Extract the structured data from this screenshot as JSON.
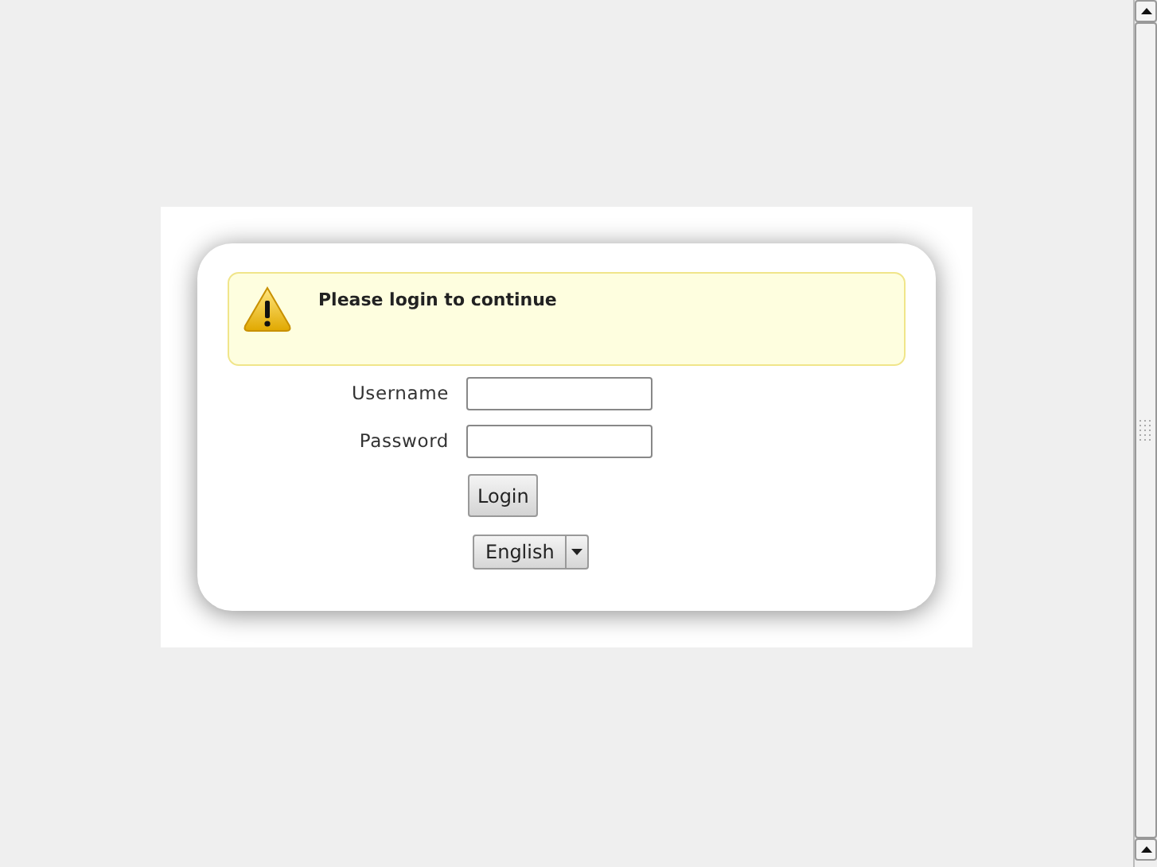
{
  "alert": {
    "kind": "warning",
    "message": "Please login to continue"
  },
  "fields": [
    {
      "label": "Username"
    },
    {
      "label": "Password"
    }
  ],
  "login_button": "Login",
  "language_select": {
    "value": "English"
  }
}
